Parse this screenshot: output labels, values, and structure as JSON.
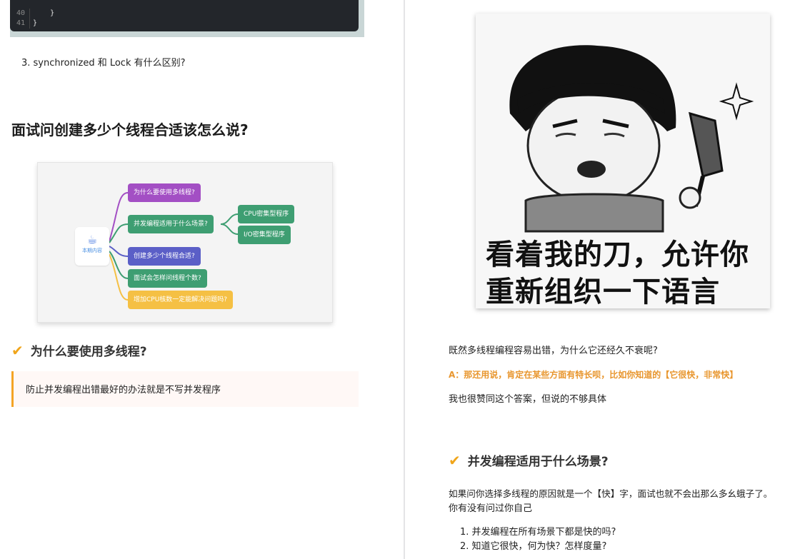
{
  "code": {
    "lines": [
      {
        "num": "40",
        "text": "    }"
      },
      {
        "num": "41",
        "text": "}"
      }
    ]
  },
  "left": {
    "question3": "3.  synchronized 和 Lock 有什么区别?",
    "section_title": "面试问创建多少个线程合适该怎么说?",
    "mindmap": {
      "center_label": "本期内容",
      "center_icon": "coffee-cup-icon",
      "nodes": [
        {
          "label": "为什么要使用多线程?",
          "color": "#a34fc4"
        },
        {
          "label": "并发编程适用于什么场景?",
          "color": "#3e9e72"
        },
        {
          "label": "CPU密集型程序",
          "color": "#3e9e72"
        },
        {
          "label": "I/O密集型程序",
          "color": "#3e9e72"
        },
        {
          "label": "创建多少个线程合适?",
          "color": "#5b5fc7"
        },
        {
          "label": "面试会怎样问线程个数?",
          "color": "#3e9e72"
        },
        {
          "label": "增加CPU核数一定能解决问题吗?",
          "color": "#f5c044"
        }
      ]
    },
    "subsection_title": "为什么要使用多线程?",
    "quote": "防止并发编程出错最好的办法就是不写并发程序"
  },
  "right": {
    "meme_caption_line1": "看着我的刀，允许你",
    "meme_caption_line2": "重新组织一下语言",
    "para1": "既然多线程编程容易出错，为什么它还经久不衰呢?",
    "answer": "A：那还用说，肯定在某些方面有特长呗，比如你知道的【它很快，非常快】",
    "para2": "我也很赞同这个答案，但说的不够具体",
    "subsection_title": "并发编程适用于什么场景?",
    "para3_line1": "如果问你选择多线程的原因就是一个【快】字，面试也就不会出那么多幺蛾子了。",
    "para3_line2": "你有没有问过你自己",
    "list": [
      "1.  并发编程在所有场景下都是快的吗?",
      "2.  知道它很快，何为快？怎样度量?"
    ]
  },
  "colors": {
    "accent_check": "#f0a51a",
    "answer_text": "#e8962e",
    "quote_border": "#f4a425"
  }
}
